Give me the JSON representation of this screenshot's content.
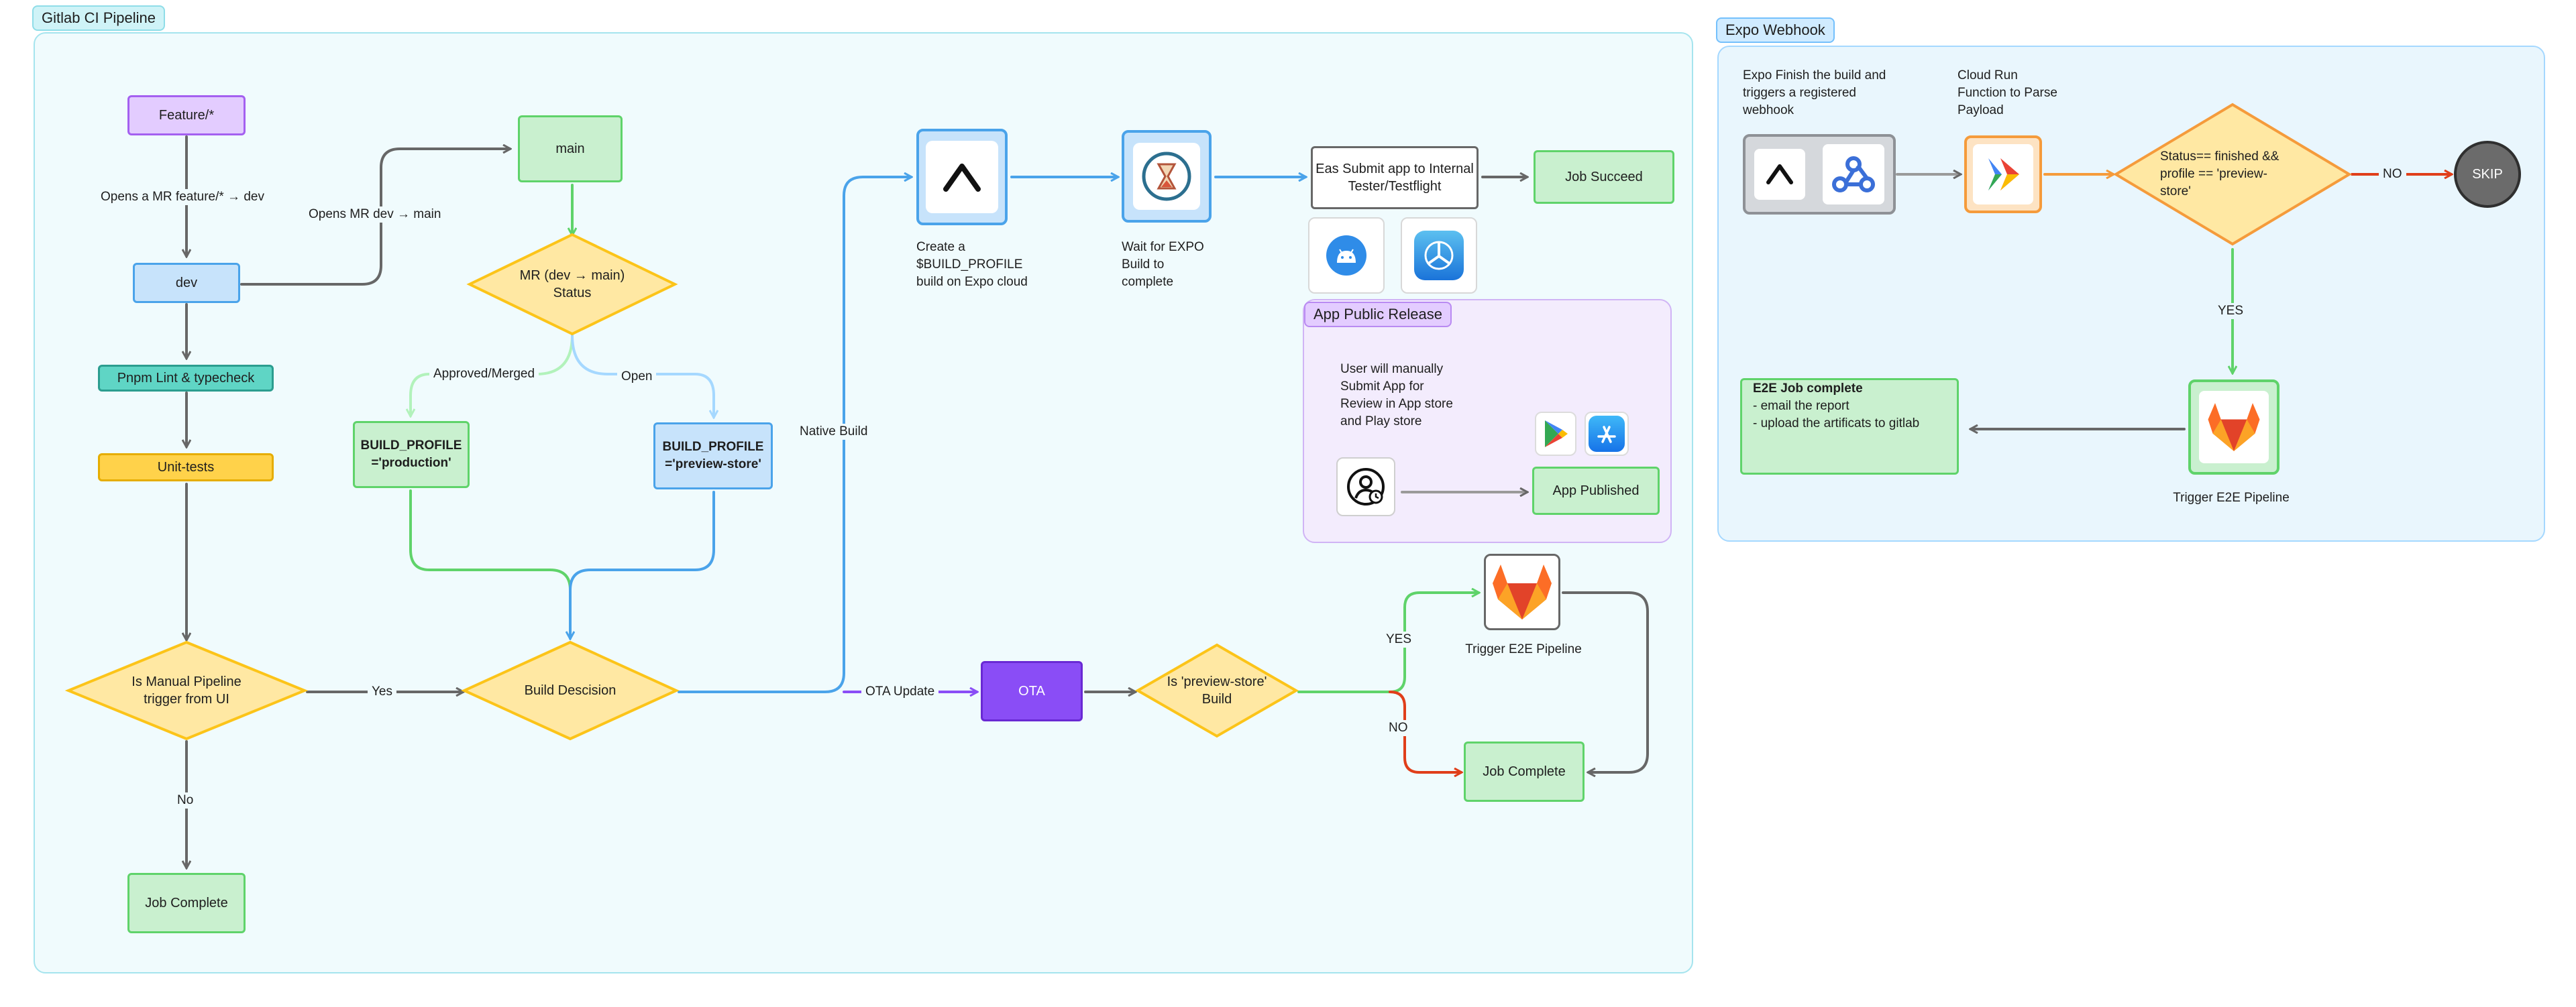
{
  "frames": {
    "gitlab_title": "Gitlab CI Pipeline",
    "expo_title": "Expo Webhook",
    "release_title": "App Public Release"
  },
  "nodes": {
    "feature": "Feature/*",
    "dev": "dev",
    "lint": "Pnpm Lint & typecheck",
    "unit_tests": "Unit-tests",
    "manual_trigger": "Is Manual Pipeline trigger from UI",
    "job_complete_left": "Job Complete",
    "main": "main",
    "mr_status": "MR (dev → main) Status",
    "build_profile_prod": "BUILD_PROFILE ='production'",
    "build_profile_preview": "BUILD_PROFILE ='preview-store'",
    "build_decision": "Build Descision",
    "create_build": "Create a $BUILD_PROFILE build on Expo cloud",
    "wait_build": "Wait for EXPO Build to complete",
    "eas_submit": "Eas Submit app to Internal Tester/Testflight",
    "job_succeed": "Job Succeed",
    "user_manual": "User will manually Submit App for Review in App store and Play store",
    "app_published": "App Published",
    "ota": "OTA",
    "is_preview": "Is 'preview-store' Build",
    "trigger_e2e_bottom": "Trigger E2E Pipeline",
    "job_complete_right": "Job Complete",
    "expo_finish": "Expo Finish the build and triggers a registered webhook",
    "cloud_run": "Cloud Run Function to Parse Payload",
    "status_check": "Status== finished && profile == 'preview-store'",
    "skip": "SKIP",
    "trigger_e2e_right": "Trigger E2E Pipeline",
    "e2e_title": "E2E Job complete",
    "e2e_line1": "- email the report",
    "e2e_line2": "- upload the artificats to gitlab"
  },
  "edge_labels": {
    "opens_mr_feature": "Opens a MR feature/* → dev",
    "opens_mr_dev": "Opens MR dev → main",
    "approved": "Approved/Merged",
    "open": "Open",
    "native_build": "Native Build",
    "yes_manual": "Yes",
    "no_manual": "No",
    "ota_update": "OTA Update",
    "yes_preview": "YES",
    "no_preview": "NO",
    "no_status": "NO",
    "yes_status": "YES"
  },
  "icons": {
    "expo": "expo-logo-icon",
    "hourglass": "hourglass-icon",
    "android": "android-icon",
    "testflight": "testflight-icon",
    "play_store": "google-play-icon",
    "app_store": "app-store-icon",
    "user": "user-clock-icon",
    "gitlab": "gitlab-icon",
    "webhook": "webhook-icon",
    "cloud_run": "cloud-run-icon"
  },
  "colors": {
    "frame_bg": "#f0fbfd",
    "arrow_gray": "#676767",
    "arrow_green": "#5fd36a",
    "arrow_blue": "#4aa3ea",
    "arrow_light_blue": "#a5d8ff",
    "arrow_purple": "#8a4df6",
    "arrow_red": "#e03e1a",
    "arrow_orange": "#f59b3b"
  }
}
